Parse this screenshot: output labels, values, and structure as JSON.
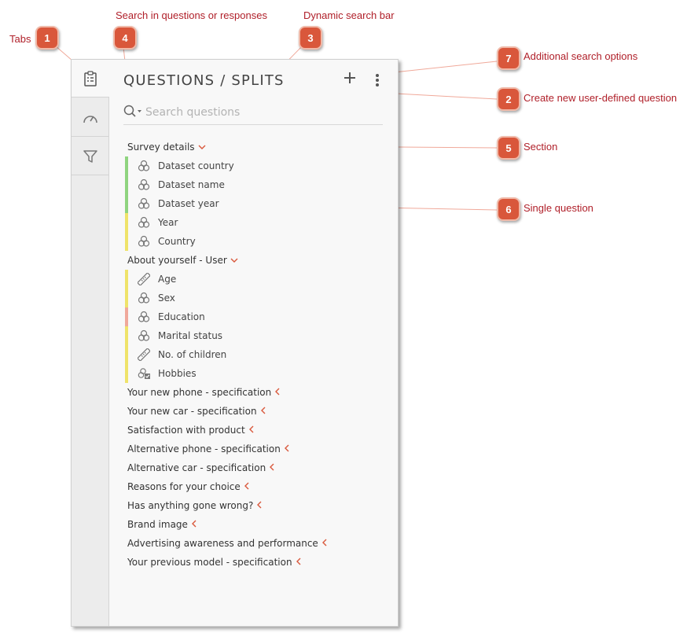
{
  "annotations": [
    {
      "id": "1",
      "label": "Tabs"
    },
    {
      "id": "2",
      "label": "Create new user-defined question"
    },
    {
      "id": "3",
      "label": "Dynamic search bar"
    },
    {
      "id": "4",
      "label": "Search in questions or responses"
    },
    {
      "id": "5",
      "label": "Section"
    },
    {
      "id": "6",
      "label": "Single question"
    },
    {
      "id": "7",
      "label": "Additional search options"
    }
  ],
  "panel": {
    "title": "QUESTIONS / SPLITS",
    "tabs": [
      "questions-tab",
      "dashboard-tab",
      "filter-tab"
    ],
    "search": {
      "placeholder": "Search questions",
      "value": ""
    }
  },
  "colors": {
    "green": "#8fd47f",
    "yellow": "#efe36a",
    "red": "#f0a89b",
    "accent": "#d9573b"
  },
  "sections": [
    {
      "name": "Survey details",
      "expanded": true,
      "questions": [
        {
          "label": "Dataset country",
          "icon": "single-choice-icon",
          "status": "green"
        },
        {
          "label": "Dataset name",
          "icon": "single-choice-icon",
          "status": "green"
        },
        {
          "label": "Dataset year",
          "icon": "single-choice-icon",
          "status": "green"
        },
        {
          "label": "Year",
          "icon": "single-choice-icon",
          "status": "yellow"
        },
        {
          "label": "Country",
          "icon": "single-choice-icon",
          "status": "yellow"
        }
      ]
    },
    {
      "name": "About yourself - User",
      "expanded": true,
      "questions": [
        {
          "label": "Age",
          "icon": "ruler-icon",
          "status": "yellow"
        },
        {
          "label": "Sex",
          "icon": "single-choice-icon",
          "status": "yellow"
        },
        {
          "label": "Education",
          "icon": "single-choice-icon",
          "status": "red"
        },
        {
          "label": "Marital status",
          "icon": "single-choice-icon",
          "status": "yellow"
        },
        {
          "label": "No. of children",
          "icon": "ruler-icon",
          "status": "yellow"
        },
        {
          "label": "Hobbies",
          "icon": "multi-choice-icon",
          "status": "yellow"
        }
      ]
    },
    {
      "name": "Your new phone - specification",
      "expanded": false,
      "questions": []
    },
    {
      "name": "Your new car - specification",
      "expanded": false,
      "questions": []
    },
    {
      "name": "Satisfaction with product",
      "expanded": false,
      "questions": []
    },
    {
      "name": "Alternative phone - specification",
      "expanded": false,
      "questions": []
    },
    {
      "name": "Alternative car - specification",
      "expanded": false,
      "questions": []
    },
    {
      "name": "Reasons for your choice",
      "expanded": false,
      "questions": []
    },
    {
      "name": "Has anything gone wrong?",
      "expanded": false,
      "questions": []
    },
    {
      "name": "Brand image",
      "expanded": false,
      "questions": []
    },
    {
      "name": "Advertising awareness and performance",
      "expanded": false,
      "questions": []
    },
    {
      "name": "Your previous model - specification",
      "expanded": false,
      "questions": []
    }
  ]
}
